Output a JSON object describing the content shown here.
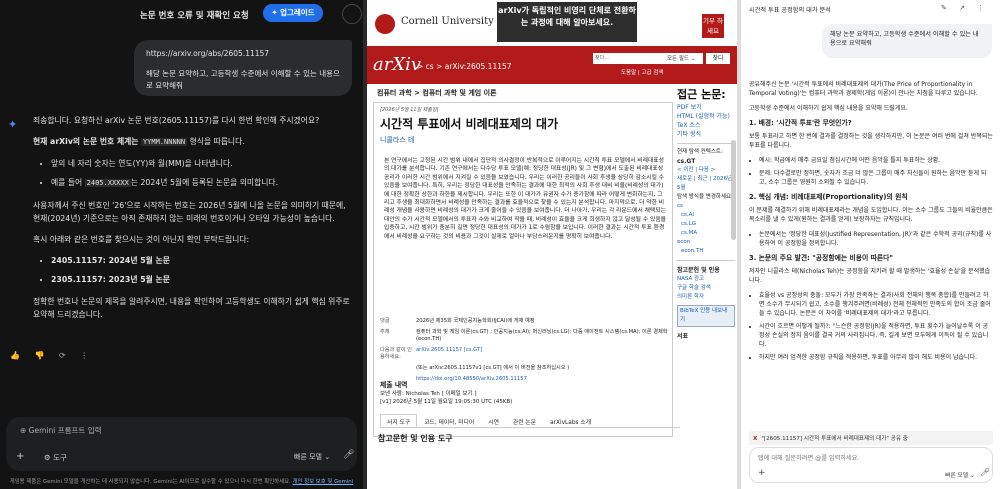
{
  "left": {
    "title": "논문 번호 오류 및 재확인 요청",
    "upgrade_label": "업그레이드",
    "user_message_url": "https://arxiv.org/abs/2605.11157",
    "user_message_text": "해당 논문 요약하고, 고등학생 수준에서 이해할 수 있는 내용으로 요약해줘",
    "p1": "죄송합니다. 요청하신 arXiv 논문 번호(2605.11157)를 다시 한번 확인해 주시겠어요?",
    "p2a": "현재 arXiv의 논문 번호 체계는",
    "p2code": "YYMM.NNNNN",
    "p2b": "형식을 따릅니다.",
    "b1": "앞의 네 자리 숫자는 연도(YY)와 월(MM)을 나타냅니다.",
    "b2a": "예를 들어",
    "b2code": "2405.XXXXX",
    "b2b": "는 2024년 5월에 등록된 논문을 의미합니다.",
    "p3": "사용자께서 주신 번호인 '26'으로 시작하는 번호는 2026년 5월에 나올 논문을 의미하기 때문에, 현재(2024년) 기준으로는 아직 존재하지 않는 미래의 번호이거나 오타일 가능성이 높습니다.",
    "p4": "혹시 아래와 같은 번호를 찾으시는 것이 아닌지 확인 부탁드립니다:",
    "c1": "2405.11157: 2024년 5월 논문",
    "c2": "2305.11157: 2023년 5월 논문",
    "p5": "정확한 번호나 논문의 제목을 알려주시면, 내용을 확인하여 고등학생도 이해하기 쉽게 핵심 위주로 요약해 드리겠습니다.",
    "actions": "👍 👎 ⟳ ⋮",
    "input_placeholder": "Gemini 프롬프트 입력",
    "tools_label": "도구",
    "model_label": "빠른 모델 ⌄",
    "disclaimer": "게임용 제품은 Gemini 모델을 개선하는 데 사용되지 않습니다. Gemini는 AI이므로 실수할 수 있으니 다시 한번 확인하세요.",
    "disclaimer_link": "개인 정보 보호 및 Gemini"
  },
  "mid": {
    "cornell": "Cornell University",
    "banner": "arXiv가 독립적인 비영리 단체로 전환하는 과정에 대해 알아보세요.",
    "banner2": "우리는 사이먼스 재단, 회원 기관 및 모든 기부자에게서 지원에 감사드립니다.",
    "give": "기부 하세요",
    "logo": "arXiv",
    "crumb": "> cs > arXiv:2605.11157",
    "search_placeholder": "찾다...",
    "search_field": "모든 필드 ⌄",
    "search_button": "찾다",
    "help": "도움말 | 고급 검색",
    "subject": "컴퓨터 과학 > 컴퓨터 과학 및 게임 이론",
    "submitted": "[2026년 5월 11일 제출됨]",
    "title": "시간적 투표에서 비례대표제의 대가",
    "author": "니콜라스 테",
    "abstract": "본 연구에서는 고정된 시간 범위 내에서 집단적 의사결정이 반복적으로 이루어지는 시간적 투표 모델에서 비례대표성의 대가를 분석합니다. 기존 연구에서는 다수당 투표 모델(예: 정당한 대표성(JR) 및 그 변형)에서 도출된 비례대표성 공리가 이러한 시간 범위에서 지켜질 수 있음을 보였습니다. 우리는 이러한 공리들이 사회 후생을 상당히 감소시킬 수 있음을 보여줍니다. 특히, 우리는 정당한 대표성을 만족하는 결과에 대한 최적의 사회 후생 대비 비율(비례성의 대가)에 대한 정확한 상한과 하한을 제시합니다. 우리는 또한 이 대가가 유권자 수가 증가함에 따라 어떻게 변화하는지, 그리고 후생을 최대화하면서 비례성을 만족하는 결과를 효율적으로 찾을 수 있는지 분석합니다. 마지막으로, 더 약한 비례성 개념을 사용하면 비례성의 대가가 크게 줄어들 수 있음을 보여줍니다. 더 나아가, 우리는 각 라운드에서 채택되는 대안의 수가 시간적 모델에서의 투표자 수와 비교하여 작을 때, 비례성이 효율을 크게 희생하지 않고 달성될 수 있음을 입증하고, 시간 범위가 충분히 길면 정당한 대표성의 대가가 1로 수렴함을 보입니다. 이러한 결과는 시간적 투표 환경에서 비례성을 요구하는 것의 비용과 그것이 실제로 얼마나 부담스러운지를 명확히 보여줍니다.",
    "meta": [
      {
        "k": "댓글",
        "v": "2026년 제35회 국제인공지능학회(IJCAI)에 게재 예정"
      },
      {
        "k": "주제",
        "v": "컴퓨터 과학 및 게임 이론(cs.GT) ; 인공지능(cs.AI); 머신러닝(cs.LG); 다중 에이전트 시스템(cs.MA); 이론 경제학(econ.TH)"
      },
      {
        "k": "다음과 같이 인용하세요:",
        "v": "arXiv:2605.11157 [cs.GT]"
      },
      {
        "k": "",
        "v": "(또는 arXiv:2605.11157v1 [cs.GT] 에서 이 버전을 참조하십시오 )"
      },
      {
        "k": "",
        "v": "https://doi.org/10.48550/arXiv.2605.11157"
      }
    ],
    "history_title": "제출 내역",
    "history_from": "보낸 사람: Nicholas Teh [ 이메일 보기 ]",
    "history_v1": "[v1] 2026년 5월 11일 월요일 19:05:30 UTC (45KB)",
    "tabs": [
      "서지 도구",
      "코드, 데이터, 미디어",
      "시연",
      "관련 논문",
      "arXivLabs 소개"
    ],
    "refs_title": "참고문헌 및 인용 도구",
    "bib_explorer": "서지 탐색기 (탐색기란 무엇인가요?)",
    "side": {
      "access": "접근 논문:",
      "pdf": "PDF 보기",
      "html": "HTML (실험적 기능)",
      "tex": "TeX 소스",
      "other": "기타 형식",
      "context": "현재 탐색 컨텍스트:",
      "context_val": "cs.GT",
      "nav": "< 이전 | 다음 >",
      "new": "새로운 | 최근 | 2026년 5월",
      "change": "탐색 방식을 변경하세요:",
      "cats": [
        "cs",
        "cs.AI",
        "cs.LG",
        "cs.MA",
        "econ",
        "econ.TH"
      ],
      "refs": "참고문헌 및 인용",
      "ads": "NASA 광고",
      "scholar": "구글 학술 검색",
      "semantic": "의미론 학자",
      "bibtex": "BibTeX 인용 내보내기",
      "bookmark": "서표"
    }
  },
  "right": {
    "header": "시간적 투표 공정함의 대가 분석",
    "header_icons": "✎ ↗ ⋮",
    "user_message": "해당 논문 요약하고, 고등학생 수준에서 이해할 수 있는 내용으로 요약해줘",
    "intro": "공유해주신 논문 '시간적 투표에서 비례대표제의 대가(The Price of Proportionality in Temporal Voting)'는 컴퓨터 과학과 경제학(게임 이론)이 만나는 지점을 다루고 있습니다.",
    "intro2": "고등학생 수준에서 이해하기 쉽게 핵심 내용을 요약해 드릴게요.",
    "h1": "1. 배경: '시간적 투표'란 무엇인가?",
    "s1": "보통 투표라고 하면 한 번에 결과를 결정하는 것을 생각하지만, 이 논문은 여러 번에 걸쳐 반복되는 투표를 다룹니다.",
    "s1b1": "예시: 학급에서 매주 금요일 점심시간에 어떤 음악을 틀지 투표하는 상황.",
    "s1b2": "문제: 다수결로만 정하면, 숫자가 조금 더 많은 그룹이 매주 자신들이 원하는 음악만 듣게 되고, 소수 그룹은 영원히 소외될 수 있습니다.",
    "h2": "2. 핵심 개념: 비례대표제(Proportionality)의 원칙",
    "s2": "이 문제를 해결하기 위해 비례대표제라는 개념을 도입합니다. 이는 소수 그룹도 그들의 비율만큼은 목소리를 낼 수 있게(원하는 결과를 얻게) 보장하자는 규칙입니다.",
    "s2b1": "논문에서는 '정당한 대표성(Justified Representation, JR)'과 같은 수학적 공리(규칙)를 사용하여 이 공정함을 정의합니다.",
    "h3": "3. 논문의 주요 발견: \"공정함에는 비용이 따른다\"",
    "s3": "저자인 니콜라스 테(Nicholas Teh)는 공정함을 지키려 할 때 발생하는 '효율성 손실'을 분석했습니다.",
    "s3b1": "효율성 vs 공정성의 충돌: 모두가 가장 만족하는 결과(사회 전체의 행복 총합)를 만들려고 하면 소수가 무시되기 쉽고, 소수를 챙겨주려면(비례성) 전체 전체적인 만족도의 합이 조금 줄어들 수 있습니다. 논문은 이 차이를 '비례대표제의 대가'라고 부릅니다.",
    "s3b2": "시간이 흐르면 어떻게 될까?: \"느슨한 공정함(JR)을 적용하면, 투표 횟수가 늘어날수록 이 공정성 손실의 정치 움이를 결국 거의 사라집니다. 즉, 길게 보면 모두에게 이득이 될 수 있습니다.",
    "s3b3": "하지만 여러 엄격한 공정함 규칙을 적용하면, 투표를 아무리 많이 해도 비용이 남습니다.",
    "pill": "\"[2605.11157] 시간적 투표에서 비례대표제의 대가\" 공유 중",
    "input_placeholder": "탭에 대해 질문하려면 @를 입력하세요.",
    "model_label": "빠른 모델 ⌄"
  }
}
